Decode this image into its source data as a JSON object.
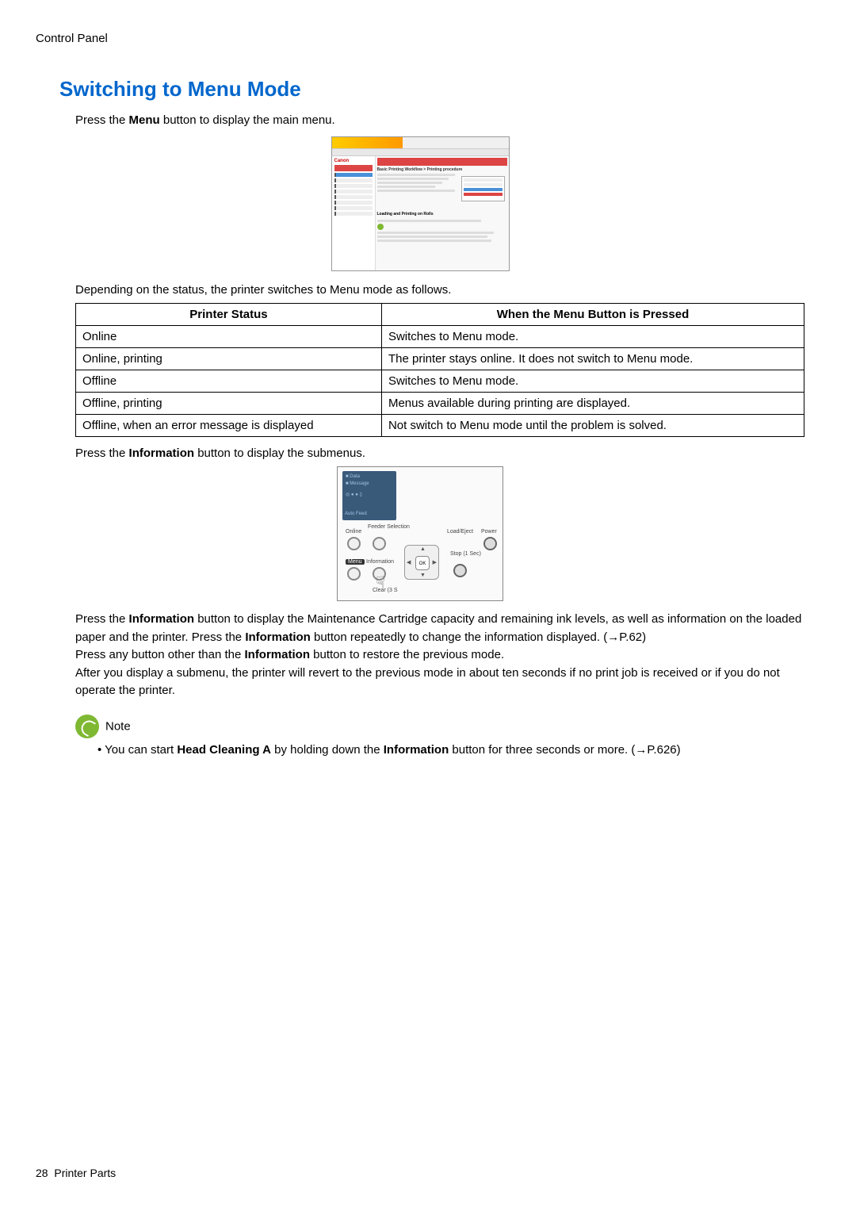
{
  "header_section": "Control Panel",
  "page_title": "Switching to Menu Mode",
  "intro_prefix": "Press the ",
  "intro_bold": "Menu",
  "intro_suffix": " button to display the main menu.",
  "status_intro": "Depending on the status, the printer switches to Menu mode as follows.",
  "table": {
    "header_status": "Printer Status",
    "header_action": "When the Menu Button is Pressed",
    "rows": [
      {
        "status": "Online",
        "action": "Switches to Menu mode."
      },
      {
        "status": "Online, printing",
        "action": "The printer stays online. It does not switch to Menu mode."
      },
      {
        "status": "Offline",
        "action": "Switches to Menu mode."
      },
      {
        "status": "Offline, printing",
        "action": "Menus available during printing are displayed."
      },
      {
        "status": "Offline, when an error message is displayed",
        "action": "Not switch to Menu mode until the problem is solved."
      }
    ]
  },
  "after_table_prefix": "Press the ",
  "after_table_bold": "Information",
  "after_table_suffix": " button to display the submenus.",
  "panel": {
    "lcd_line1": "■ Data",
    "lcd_line2": "■ Message",
    "lcd_autofeed": "Auto Feed",
    "online": "Online",
    "feeder": "Feeder Selection",
    "loadeject": "Load/Eject",
    "power": "Power",
    "menu": "Menu",
    "information": "Information",
    "ok": "OK",
    "stop": "Stop (1 Sec)",
    "clear": "Clear (3 S"
  },
  "body_paragraphs": {
    "p1_a": "Press the ",
    "p1_b": "Information",
    "p1_c": " button to display the Maintenance Cartridge capacity and remaining ink levels, as well as information on the loaded paper and the printer. Press the ",
    "p1_d": "Information",
    "p1_e": " button repeatedly to change the information displayed.  (→P.62)",
    "p2_a": "Press any button other than the ",
    "p2_b": "Information",
    "p2_c": " button to restore the previous mode.",
    "p3": "After you display a submenu, the printer will revert to the previous mode in about ten seconds if no print job is received or if you do not operate the printer."
  },
  "note": {
    "label": "Note",
    "item_a": "You can start ",
    "item_b": "Head Cleaning A",
    "item_c": " by holding down the ",
    "item_d": "Information",
    "item_e": " button for three seconds or more. (→P.626)"
  },
  "footer_page": "28",
  "footer_label": "Printer Parts"
}
